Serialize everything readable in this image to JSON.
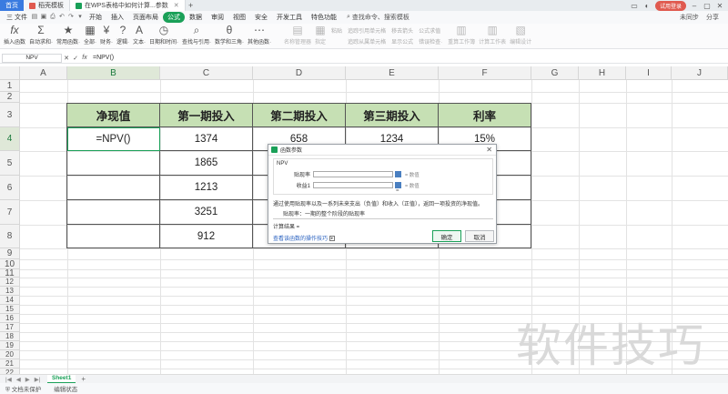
{
  "titlebar": {
    "tabs": [
      {
        "label": "首页"
      },
      {
        "label": "稻壳模板"
      },
      {
        "label": "在WPS表格中如何计算...参数"
      }
    ],
    "new_tab": "+",
    "sync": "未同步",
    "share": "分享",
    "login": "试用登录"
  },
  "menubar": {
    "file": "三 文件",
    "items": [
      "开始",
      "插入",
      "页面布局",
      "公式",
      "数据",
      "审阅",
      "视图",
      "安全",
      "开发工具",
      "特色功能"
    ],
    "active": "公式",
    "search": "查找命令、搜索模板",
    "right": [
      "未同步",
      "分享"
    ]
  },
  "ribbon": {
    "buttons": [
      {
        "icon": "fx",
        "label": "插入函数"
      },
      {
        "icon": "Σ",
        "label": "自动求和·"
      },
      {
        "icon": "★",
        "label": "常用函数·"
      },
      {
        "icon": "▦",
        "label": "全部·"
      },
      {
        "icon": "¥",
        "label": "财务·"
      },
      {
        "icon": "?",
        "label": "逻辑·"
      },
      {
        "icon": "A",
        "label": "文本·"
      },
      {
        "icon": "◷",
        "label": "日期和时间·"
      },
      {
        "icon": "⌕",
        "label": "查找与引用·"
      },
      {
        "icon": "θ",
        "label": "数学和三角·"
      },
      {
        "icon": "⋯",
        "label": "其他函数·"
      }
    ],
    "disabled_large": [
      "名称管理器",
      "指定"
    ],
    "disabled_small": [
      [
        "粘贴",
        "追踪引用单元格",
        "移去箭头"
      ],
      [
        "追踪从属单元格",
        "显示公式"
      ],
      [
        "公式求值",
        "错误检查·"
      ]
    ],
    "disabled_tail": [
      "重算工作簿",
      "计算工作表",
      "编辑设计"
    ]
  },
  "formulabar": {
    "namebox": "NPV",
    "fx_cancel": "✕",
    "fx_confirm": "✓",
    "fx_icon": "fx",
    "formula": "=NPV()"
  },
  "columns": [
    "A",
    "B",
    "C",
    "D",
    "E",
    "F",
    "G",
    "H",
    "I",
    "J"
  ],
  "rows": [
    "1",
    "2",
    "3",
    "4",
    "5",
    "6",
    "7",
    "8",
    "9",
    "10",
    "11",
    "12",
    "13",
    "14",
    "15",
    "16",
    "17",
    "18",
    "19",
    "20",
    "21",
    "22",
    "23"
  ],
  "table": {
    "headers": [
      "净现值",
      "第一期投入",
      "第二期投入",
      "第三期投入",
      "利率"
    ],
    "row4": [
      "=NPV()",
      "1374",
      "658",
      "1234",
      "15%"
    ],
    "col_c": [
      "1865",
      "1213",
      "3251",
      "912"
    ]
  },
  "dialog": {
    "title": "函数参数",
    "function": "NPV",
    "args": [
      {
        "label": "贴现率",
        "eq": "= 数值"
      },
      {
        "label": "收益1",
        "eq": "= 数值"
      }
    ],
    "result_eq": "=",
    "description": "通过使用贴现率以及一系列未来支出（负值）和收入（正值），返回一项投资的净现值。",
    "hint": "贴现率：一期的整个阶段的贴现率",
    "result": "计算结果 =",
    "help_link": "查看该函数的操作技巧",
    "ok": "确定",
    "cancel": "取消"
  },
  "sheets": {
    "nav": [
      "|◀",
      "◀",
      "▶",
      "▶|"
    ],
    "active": "Sheet1",
    "add": "+"
  },
  "statusbar": {
    "items": [
      "文档未保护",
      "编辑状态"
    ]
  },
  "watermark": "软件技巧"
}
